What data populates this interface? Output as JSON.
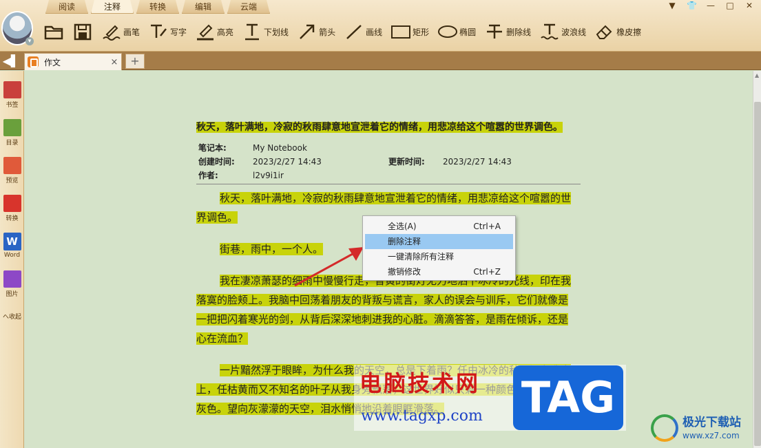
{
  "menu_tabs": [
    {
      "label": "阅读"
    },
    {
      "label": "注释",
      "active": true
    },
    {
      "label": "转换"
    },
    {
      "label": "编辑"
    },
    {
      "label": "云端"
    }
  ],
  "toolbar": {
    "open_icon": "folder-icon",
    "save_icon": "save-icon",
    "tools": [
      {
        "label": "画笔",
        "icon": "brush-icon"
      },
      {
        "label": "写字",
        "icon": "pen-write-icon"
      },
      {
        "label": "高亮",
        "icon": "highlighter-icon"
      },
      {
        "label": "下划线",
        "icon": "underline-icon"
      },
      {
        "label": "箭头",
        "icon": "arrow-icon"
      },
      {
        "label": "画线",
        "icon": "line-icon"
      },
      {
        "label": "矩形",
        "icon": "rectangle-icon"
      },
      {
        "label": "椭圆",
        "icon": "ellipse-icon"
      },
      {
        "label": "删除线",
        "icon": "strikethrough-icon"
      },
      {
        "label": "波浪线",
        "icon": "wavy-line-icon"
      },
      {
        "label": "橡皮擦",
        "icon": "eraser-icon"
      }
    ]
  },
  "window_controls": {
    "dropdown": "▼",
    "skin": "👕",
    "minimize": "—",
    "maximize": "□",
    "close": "✕"
  },
  "tab": {
    "label": "作文",
    "close": "×",
    "add": "+",
    "back": "◀▌"
  },
  "sidebar": {
    "items": [
      {
        "label": "书签",
        "icon": "bookmark-icon",
        "color": "#c9403c"
      },
      {
        "label": "目录",
        "icon": "toc-icon",
        "color": "#6aa03c"
      },
      {
        "label": "预览",
        "icon": "preview-icon",
        "color": "#e05a3a"
      },
      {
        "label": "转换",
        "icon": "pdf-convert-icon",
        "color": "#d8342c"
      },
      {
        "label": "Word",
        "icon": "word-icon",
        "color": "#2b65c4"
      },
      {
        "label": "图片",
        "icon": "image-icon",
        "color": "#8d48c6"
      }
    ],
    "collapse": "へ收起"
  },
  "document": {
    "title": "秋天，落叶满地，冷寂的秋雨肆意地宣泄着它的情绪，用悲凉给这个喧嚣的世界调色。",
    "meta": {
      "notebook_label": "笔记本:",
      "notebook": "My Notebook",
      "created_label": "创建时间:",
      "created": "2023/2/27 14:43",
      "updated_label": "更新时间:",
      "updated": "2023/2/27 14:43",
      "author_label": "作者:",
      "author": "l2v9i1ir"
    },
    "paragraphs": [
      "秋天，落叶满地，冷寂的秋雨肆意地宣泄着它的情绪，用悲凉给这个喧嚣的世界调色。",
      "街巷，雨中，一个人。",
      "我在凄凉萧瑟的细雨中慢慢行走，昏黄的街灯无力地洒下冰冷的光线，印在我落寞的脸颊上。我脑中回荡着朋友的背叛与谎言，家人的误会与训斥，它们就像是一把把闪着寒光的剑，从背后深深地刺进我的心脏。滴滴答答，是雨在倾诉，还是心在流血？",
      "一片黯然浮于眼眸，为什么我的天空，总是下着雨？任由冰冷的秋雨洒在我身上，任枯黄而又不知名的叶子从我身旁飘落，这世界好似只剩一种颜色——冰冷的灰色。望向灰濛濛的天空，泪水悄悄地沿着眼眶滑落。"
    ]
  },
  "context_menu": {
    "items": [
      {
        "label": "全选(A)",
        "shortcut": "Ctrl+A"
      },
      {
        "label": "删除注释",
        "shortcut": "",
        "hover": true
      },
      {
        "label": "一键清除所有注释",
        "shortcut": ""
      },
      {
        "label": "撤销修改",
        "shortcut": "Ctrl+Z"
      }
    ]
  },
  "watermarks": {
    "site_name": "电脑技术网",
    "site_url": "www.tagxp.com",
    "tag": "TAG",
    "brand2_name": "极光下载站",
    "brand2_url": "www.xz7.com"
  },
  "colors": {
    "highlight": "#c8d30a",
    "page_bg": "#d5e3c9",
    "menu_hover": "#99c9f2",
    "arrow": "#d42a2a"
  }
}
